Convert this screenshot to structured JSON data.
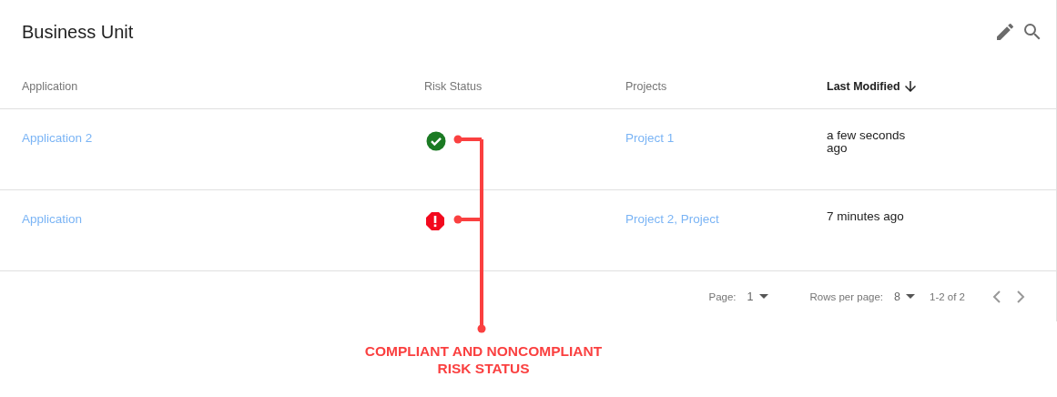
{
  "card": {
    "title": "Business Unit"
  },
  "table": {
    "columns": [
      {
        "label": "Application",
        "sorted": false
      },
      {
        "label": "Risk Status",
        "sorted": false
      },
      {
        "label": "Projects",
        "sorted": false
      },
      {
        "label": "Last Modified",
        "sorted": true
      }
    ],
    "rows": [
      {
        "application": "Application 2",
        "risk_status": {
          "kind": "compliant"
        },
        "projects": "Project 1",
        "last_modified": "a few seconds ago"
      },
      {
        "application": "Application",
        "risk_status": {
          "kind": "noncompliant"
        },
        "projects": "Project 2, Project",
        "last_modified": "7 minutes ago"
      }
    ]
  },
  "pagination": {
    "page_label": "Page:",
    "page": "1",
    "rows_label": "Rows per page:",
    "rows_per_page": "8",
    "range": "1-2 of 2"
  },
  "annotation": {
    "lines": [
      "COMPLIANT AND NONCOMPLIANT",
      "RISK STATUS"
    ]
  }
}
